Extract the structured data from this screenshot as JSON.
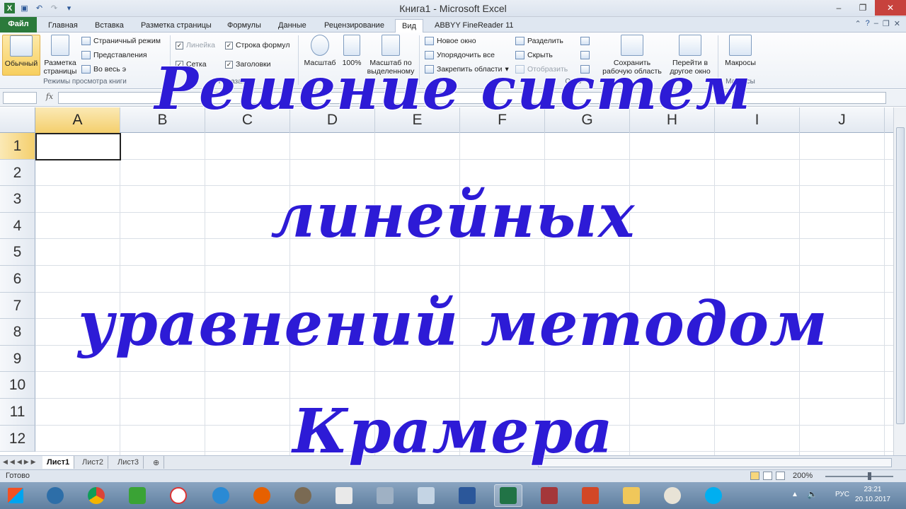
{
  "window": {
    "title": "Книга1 - Microsoft Excel"
  },
  "ribbon_tabs": [
    {
      "label": "Файл"
    },
    {
      "label": "Главная"
    },
    {
      "label": "Вставка"
    },
    {
      "label": "Разметка страницы"
    },
    {
      "label": "Формулы"
    },
    {
      "label": "Данные"
    },
    {
      "label": "Рецензирование"
    },
    {
      "label": "Вид"
    },
    {
      "label": "ABBYY FineReader 11"
    }
  ],
  "ribbon": {
    "views": {
      "normal": "Обычный",
      "page_layout": "Разметка страницы",
      "page_break": "Страничный режим",
      "custom_views": "Представления",
      "fullscreen": "Во весь э",
      "group_label": "Режимы просмотра книги"
    },
    "show": {
      "ruler": "Линейка",
      "formula_bar": "Строка формул",
      "gridlines": "Сетка",
      "headings": "Заголовки",
      "group_label": "Показать"
    },
    "zoom": {
      "zoom": "Масштаб",
      "hundred": "100%",
      "zoom_selection": "Масштаб по выделенному"
    },
    "window": {
      "new_window": "Новое окно",
      "arrange_all": "Упорядочить все",
      "freeze": "Закрепить области",
      "split": "Разделить",
      "hide": "Скрыть",
      "unhide": "Отобразить",
      "group_label": "Окно",
      "save_workspace": "Сохранить рабочую область",
      "switch_window": "Перейти в другое окно"
    },
    "macros": {
      "label": "Макросы",
      "group_label": "Макросы"
    }
  },
  "formula_bar": {
    "fx": "fx",
    "value": ""
  },
  "grid": {
    "columns": [
      "A",
      "B",
      "C",
      "D",
      "E",
      "F",
      "G",
      "H",
      "I",
      "J"
    ],
    "rows": [
      "1",
      "2",
      "3",
      "4",
      "5",
      "6",
      "7",
      "8",
      "9",
      "10",
      "11",
      "12"
    ],
    "active_cell": "A1"
  },
  "sheets": [
    {
      "label": "Лист1",
      "active": true
    },
    {
      "label": "Лист2",
      "active": false
    },
    {
      "label": "Лист3",
      "active": false
    }
  ],
  "status": {
    "ready": "Готово",
    "zoom": "200%"
  },
  "taskbar": {
    "lang": "РУС",
    "time": "23:21",
    "date": "20.10.2017"
  },
  "overlay": {
    "line1": "Решение систем",
    "line2": "линейных",
    "line3": "уравнений методом",
    "line4": "Крамера",
    "color": "#2d1bd6"
  },
  "colors": {
    "file_tab": "#2b7a3b",
    "selection": "#f4cf6d",
    "close": "#c7423d"
  }
}
